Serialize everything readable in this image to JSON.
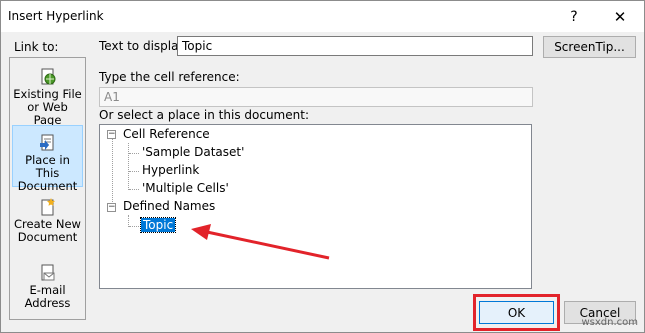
{
  "window": {
    "title": "Insert Hyperlink",
    "help": "?",
    "close": "✕"
  },
  "link_to": {
    "label": "Link to:",
    "items": [
      {
        "line1": "Existing File",
        "line2": "or Web Page",
        "icon": "web-page-icon"
      },
      {
        "line1": "Place in This",
        "line2": "Document",
        "icon": "document-place-icon"
      },
      {
        "line1": "Create New",
        "line2": "Document",
        "icon": "new-document-icon"
      },
      {
        "line1": "E-mail",
        "line2": "Address",
        "icon": "email-icon"
      }
    ]
  },
  "text_to_display": {
    "label": "Text to display:",
    "value": "Topic"
  },
  "screentip": {
    "label": "ScreenTip..."
  },
  "cell_reference": {
    "label": "Type the cell reference:",
    "value": "A1"
  },
  "place_label": "Or select a place in this document:",
  "tree": {
    "cell_reference_group": "Cell Reference",
    "cell_items": [
      "'Sample Dataset'",
      "Hyperlink",
      "'Multiple Cells'"
    ],
    "defined_names_group": "Defined Names",
    "defined_items": [
      "Topic"
    ],
    "collapse_glyph": "−"
  },
  "buttons": {
    "ok": "OK",
    "cancel": "Cancel"
  },
  "annotation_color": "#e2232a",
  "watermark": "wsxdn.com"
}
